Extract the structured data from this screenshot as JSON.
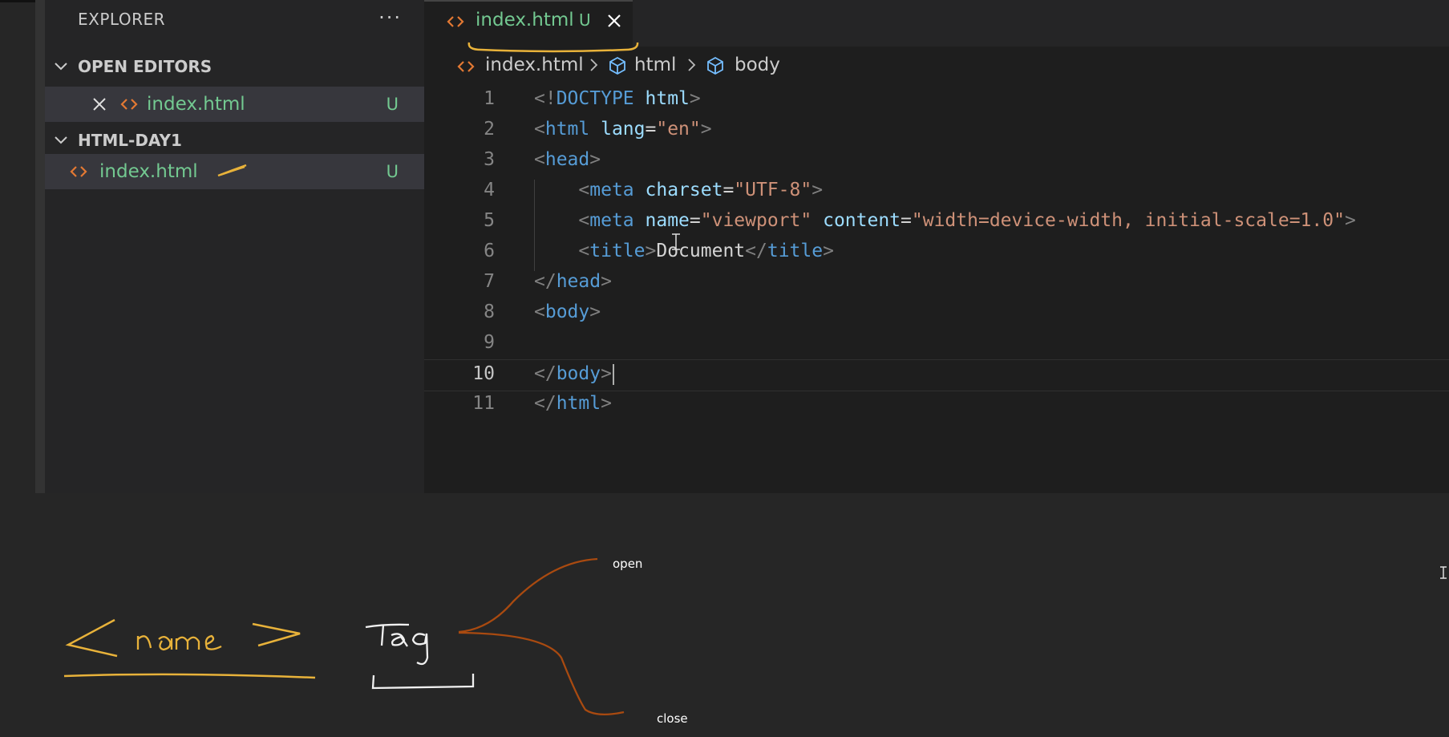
{
  "sidebar": {
    "title": "EXPLORER",
    "more_label": "···",
    "open_editors": {
      "header": "OPEN EDITORS",
      "files": [
        {
          "name": "index.html",
          "status": "U"
        }
      ]
    },
    "folder": {
      "header": "HTML-DAY1",
      "files": [
        {
          "name": "index.html",
          "status": "U"
        }
      ]
    }
  },
  "editor": {
    "tab": {
      "name": "index.html",
      "status": "U"
    },
    "breadcrumb": [
      "index.html",
      "html",
      "body"
    ],
    "current_line": 10,
    "lines": [
      {
        "num": "1",
        "tokens": [
          [
            "punc",
            "<!"
          ],
          [
            "tag",
            "DOCTYPE"
          ],
          [
            "text",
            " "
          ],
          [
            "attr",
            "html"
          ],
          [
            "punc",
            ">"
          ]
        ]
      },
      {
        "num": "2",
        "tokens": [
          [
            "punc",
            "<"
          ],
          [
            "tag",
            "html"
          ],
          [
            "text",
            " "
          ],
          [
            "attr",
            "lang"
          ],
          [
            "text",
            "="
          ],
          [
            "str",
            "\"en\""
          ],
          [
            "punc",
            ">"
          ]
        ]
      },
      {
        "num": "3",
        "tokens": [
          [
            "punc",
            "<"
          ],
          [
            "tag",
            "head"
          ],
          [
            "punc",
            ">"
          ]
        ]
      },
      {
        "num": "4",
        "tokens": [
          [
            "text",
            "    "
          ],
          [
            "punc",
            "<"
          ],
          [
            "tag",
            "meta"
          ],
          [
            "text",
            " "
          ],
          [
            "attr",
            "charset"
          ],
          [
            "text",
            "="
          ],
          [
            "str",
            "\"UTF-8\""
          ],
          [
            "punc",
            ">"
          ]
        ]
      },
      {
        "num": "5",
        "tokens": [
          [
            "text",
            "    "
          ],
          [
            "punc",
            "<"
          ],
          [
            "tag",
            "meta"
          ],
          [
            "text",
            " "
          ],
          [
            "attr",
            "name"
          ],
          [
            "text",
            "="
          ],
          [
            "str",
            "\"viewport\""
          ],
          [
            "text",
            " "
          ],
          [
            "attr",
            "content"
          ],
          [
            "text",
            "="
          ],
          [
            "str",
            "\"width=device-width, initial-scale=1.0\""
          ],
          [
            "punc",
            ">"
          ]
        ]
      },
      {
        "num": "6",
        "tokens": [
          [
            "text",
            "    "
          ],
          [
            "punc",
            "<"
          ],
          [
            "tag",
            "title"
          ],
          [
            "punc",
            ">"
          ],
          [
            "text",
            "Document"
          ],
          [
            "punc",
            "</"
          ],
          [
            "tag",
            "title"
          ],
          [
            "punc",
            ">"
          ]
        ]
      },
      {
        "num": "7",
        "tokens": [
          [
            "punc",
            "</"
          ],
          [
            "tag",
            "head"
          ],
          [
            "punc",
            ">"
          ]
        ]
      },
      {
        "num": "8",
        "tokens": [
          [
            "punc",
            "<"
          ],
          [
            "tag",
            "body"
          ],
          [
            "punc",
            ">"
          ]
        ]
      },
      {
        "num": "9",
        "tokens": []
      },
      {
        "num": "10",
        "tokens": [
          [
            "punc",
            "</"
          ],
          [
            "tag",
            "body"
          ],
          [
            "punc",
            ">"
          ]
        ]
      },
      {
        "num": "11",
        "tokens": [
          [
            "punc",
            "</"
          ],
          [
            "tag",
            "html"
          ],
          [
            "punc",
            ">"
          ]
        ]
      }
    ]
  },
  "whiteboard": {
    "labels": {
      "open": "open",
      "close": "close"
    },
    "ink_color": "#e8b23a",
    "branch_color": "#a94a10"
  }
}
